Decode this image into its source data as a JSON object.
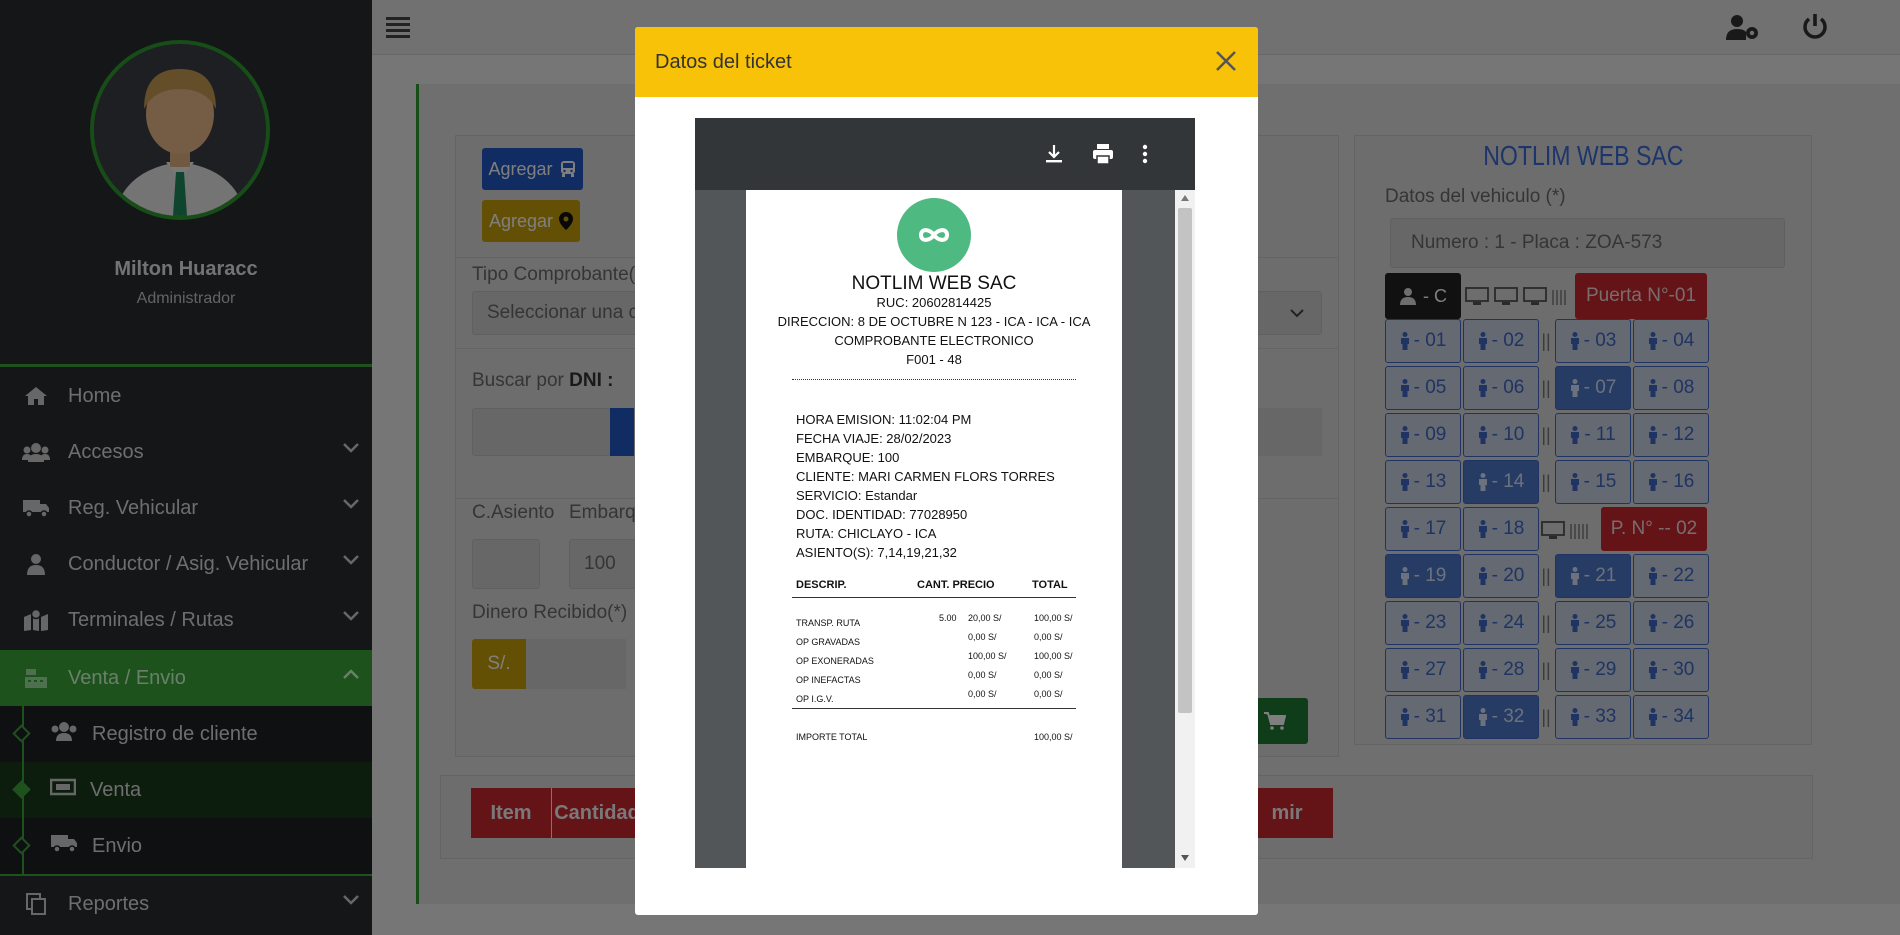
{
  "sidebar": {
    "user_name": "Milton Huaracc",
    "user_role": "Administrador",
    "nav": [
      {
        "label": "Home",
        "icon": "home-icon"
      },
      {
        "label": "Accesos",
        "icon": "users-icon"
      },
      {
        "label": "Reg. Vehicular",
        "icon": "truck-icon"
      },
      {
        "label": "Conductor / Asig. Vehicular",
        "icon": "user-icon"
      },
      {
        "label": "Terminales / Rutas",
        "icon": "map-marked-icon"
      },
      {
        "label": "Venta / Envio",
        "icon": "cash-register-icon"
      },
      {
        "label": "Reportes",
        "icon": "copy-icon"
      }
    ],
    "sub": [
      {
        "label": "Registro de cliente",
        "icon": "users-icon"
      },
      {
        "label": "Venta",
        "icon": "money-bill-icon"
      },
      {
        "label": "Envio",
        "icon": "truck-moving-icon"
      }
    ]
  },
  "form": {
    "agregar_bus": "Agregar",
    "agregar_place": "Agregar",
    "tipo_comprobante_label": "Tipo Comprobante(*)",
    "tipo_comprobante_value": "Seleccionar una op",
    "buscar_label_prefix": "Buscar por",
    "buscar_label_bold": "DNI :",
    "c_asiento_label": "C.Asiento",
    "embarque_label": "Embarqu",
    "embarque_value": "100",
    "dinero_label": "Dinero Recibido(*)",
    "currency": "S/.",
    "sale_button_tail": "a"
  },
  "table": {
    "headers": [
      "Item",
      "Cantidad"
    ],
    "right_button": "mir"
  },
  "vehicle": {
    "company": "NOTLIM WEB SAC",
    "datos_label": "Datos del vehiculo (*)",
    "info": "Numero : 1 -  Placa : ZOA-573",
    "driver": "- C",
    "door1": "Puerta N°-01",
    "door2": "P. N° -- 02",
    "seats": [
      {
        "label": "- 01",
        "selected": false
      },
      {
        "label": "- 02",
        "selected": false
      },
      {
        "label": "- 03",
        "selected": false
      },
      {
        "label": "- 04",
        "selected": false
      },
      {
        "label": "- 05",
        "selected": false
      },
      {
        "label": "- 06",
        "selected": false
      },
      {
        "label": "- 07",
        "selected": true
      },
      {
        "label": "- 08",
        "selected": false
      },
      {
        "label": "- 09",
        "selected": false
      },
      {
        "label": "- 10",
        "selected": false
      },
      {
        "label": "- 11",
        "selected": false
      },
      {
        "label": "- 12",
        "selected": false
      },
      {
        "label": "- 13",
        "selected": false
      },
      {
        "label": "- 14",
        "selected": true
      },
      {
        "label": "- 15",
        "selected": false
      },
      {
        "label": "- 16",
        "selected": false
      },
      {
        "label": "- 17",
        "selected": false
      },
      {
        "label": "- 18",
        "selected": false
      },
      {
        "label": "- 19",
        "selected": true
      },
      {
        "label": "- 20",
        "selected": false
      },
      {
        "label": "- 21",
        "selected": true
      },
      {
        "label": "- 22",
        "selected": false
      },
      {
        "label": "- 23",
        "selected": false
      },
      {
        "label": "- 24",
        "selected": false
      },
      {
        "label": "- 25",
        "selected": false
      },
      {
        "label": "- 26",
        "selected": false
      },
      {
        "label": "- 27",
        "selected": false
      },
      {
        "label": "- 28",
        "selected": false
      },
      {
        "label": "- 29",
        "selected": false
      },
      {
        "label": "- 30",
        "selected": false
      },
      {
        "label": "- 31",
        "selected": false
      },
      {
        "label": "- 32",
        "selected": true
      },
      {
        "label": "- 33",
        "selected": false
      },
      {
        "label": "- 34",
        "selected": false
      }
    ]
  },
  "modal": {
    "title": "Datos del ticket",
    "ticket": {
      "company": "NOTLIM WEB SAC",
      "ruc": "RUC: 20602814425",
      "direccion": "DIRECCION: 8 DE OCTUBRE N 123 - ICA - ICA - ICA",
      "tipo": "COMPROBANTE ELECTRONICO",
      "serie": "F001 - 48",
      "hora": "HORA EMISION: 11:02:04 PM",
      "fecha": "FECHA VIAJE: 28/02/2023",
      "embarque": "EMBARQUE: 100",
      "cliente": "CLIENTE: MARI CARMEN FLORS TORRES",
      "servicio": "SERVICIO: Estandar",
      "doc": "DOC. IDENTIDAD: 77028950",
      "ruta": "RUTA: CHICLAYO - ICA",
      "asientos": "ASIENTO(S): 7,14,19,21,32",
      "col_descrip": "DESCRIP.",
      "col_cant": "CANT. PRECIO",
      "col_total": "TOTAL",
      "rows": [
        {
          "desc": "TRANSP. RUTA",
          "cant": "5.00",
          "precio": "20,00  S/",
          "total": "100,00  S/"
        },
        {
          "desc": "OP GRAVADAS",
          "cant": "",
          "precio": "0,00  S/",
          "total": "0,00  S/"
        },
        {
          "desc": "OP EXONERADAS",
          "cant": "",
          "precio": "100,00  S/",
          "total": "100,00  S/"
        },
        {
          "desc": "OP INEFACTAS",
          "cant": "",
          "precio": "0,00  S/",
          "total": "0,00  S/"
        },
        {
          "desc": "OP I.G.V.",
          "cant": "",
          "precio": "0,00  S/",
          "total": "0,00  S/"
        }
      ],
      "importe_label": "IMPORTE TOTAL",
      "importe_value": "100,00  S/"
    }
  },
  "colors": {
    "accent": "#3aa43a",
    "modal_header": "#f8c209",
    "seat_blue": "#3f68c4",
    "danger": "#c8262f"
  }
}
